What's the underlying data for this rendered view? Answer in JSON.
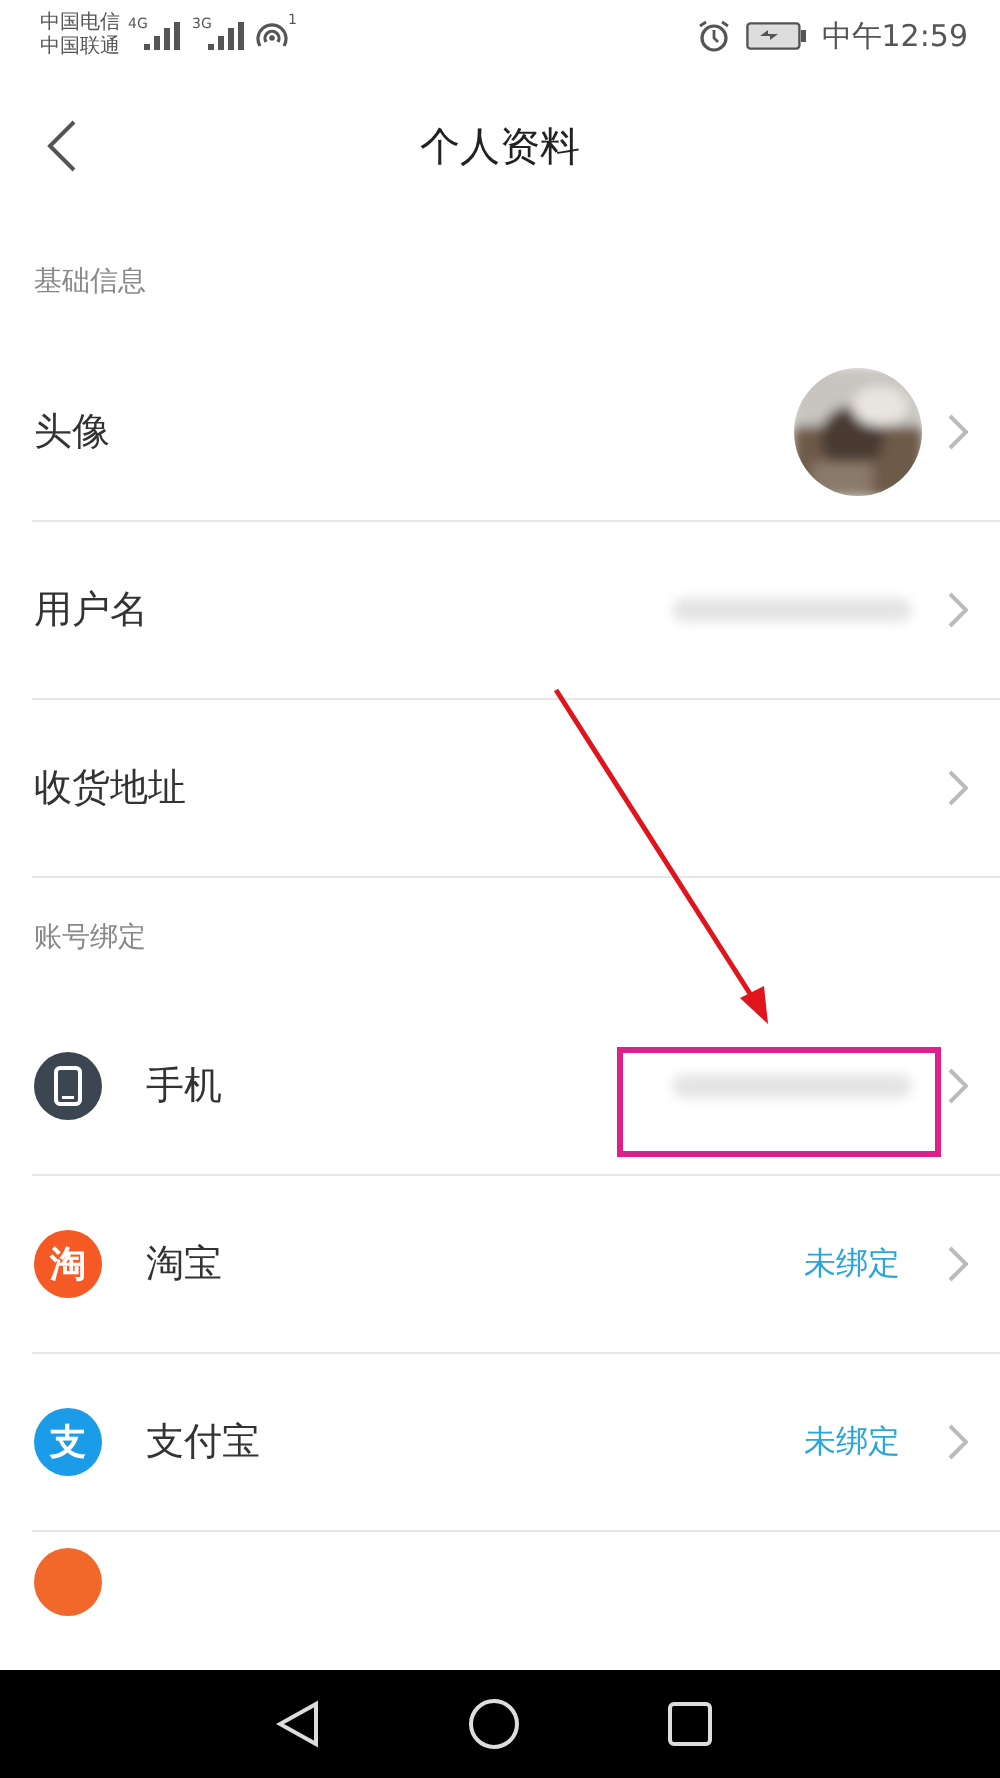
{
  "status_bar": {
    "carriers": [
      "中国电信",
      "中国联通"
    ],
    "signals": [
      {
        "label": "4G"
      },
      {
        "label": "3G"
      }
    ],
    "hotspot_count": "1",
    "time": "中午12:59"
  },
  "header": {
    "title": "个人资料"
  },
  "sections": [
    {
      "title": "基础信息",
      "rows": [
        {
          "kind": "avatar",
          "label": "头像"
        },
        {
          "kind": "hidden",
          "label": "用户名"
        },
        {
          "kind": "plain",
          "label": "收货地址"
        }
      ]
    },
    {
      "title": "账号绑定",
      "rows": [
        {
          "kind": "hidden",
          "label": "手机",
          "color": "#3b4650"
        },
        {
          "kind": "status",
          "label": "淘宝",
          "logo_text": "淘",
          "color": "#f55a24",
          "value": "未绑定"
        },
        {
          "kind": "status",
          "label": "支付宝",
          "logo_text": "支",
          "color": "#1a9ce8",
          "value": "未绑定"
        },
        {
          "kind": "peek",
          "color": "#f2682a"
        }
      ]
    }
  ],
  "annotation": {
    "arrow": true,
    "highlight": true
  }
}
